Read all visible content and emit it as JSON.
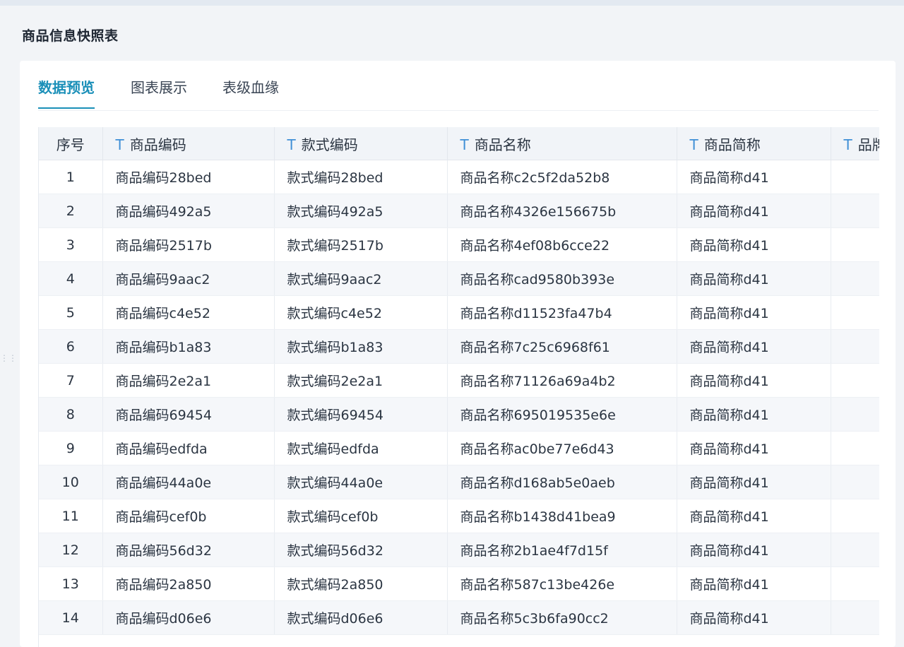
{
  "page": {
    "title": "商品信息快照表"
  },
  "tabs": [
    {
      "label": "数据预览",
      "active": true
    },
    {
      "label": "图表展示",
      "active": false
    },
    {
      "label": "表级血缘",
      "active": false
    }
  ],
  "table": {
    "columns": [
      "序号",
      "商品编码",
      "款式编码",
      "商品名称",
      "商品简称",
      "品牌"
    ],
    "column_type_icon": "T",
    "rows": [
      [
        "1",
        "商品编码28bed",
        "款式编码28bed",
        "商品名称c2c5f2da52b8",
        "商品简称d41",
        ""
      ],
      [
        "2",
        "商品编码492a5",
        "款式编码492a5",
        "商品名称4326e156675b",
        "商品简称d41",
        ""
      ],
      [
        "3",
        "商品编码2517b",
        "款式编码2517b",
        "商品名称4ef08b6cce22",
        "商品简称d41",
        ""
      ],
      [
        "4",
        "商品编码9aac2",
        "款式编码9aac2",
        "商品名称cad9580b393e",
        "商品简称d41",
        ""
      ],
      [
        "5",
        "商品编码c4e52",
        "款式编码c4e52",
        "商品名称d11523fa47b4",
        "商品简称d41",
        ""
      ],
      [
        "6",
        "商品编码b1a83",
        "款式编码b1a83",
        "商品名称7c25c6968f61",
        "商品简称d41",
        ""
      ],
      [
        "7",
        "商品编码2e2a1",
        "款式编码2e2a1",
        "商品名称71126a69a4b2",
        "商品简称d41",
        ""
      ],
      [
        "8",
        "商品编码69454",
        "款式编码69454",
        "商品名称695019535e6e",
        "商品简称d41",
        ""
      ],
      [
        "9",
        "商品编码edfda",
        "款式编码edfda",
        "商品名称ac0be77e6d43",
        "商品简称d41",
        ""
      ],
      [
        "10",
        "商品编码44a0e",
        "款式编码44a0e",
        "商品名称d168ab5e0aeb",
        "商品简称d41",
        ""
      ],
      [
        "11",
        "商品编码cef0b",
        "款式编码cef0b",
        "商品名称b1438d41bea9",
        "商品简称d41",
        ""
      ],
      [
        "12",
        "商品编码56d32",
        "款式编码56d32",
        "商品名称2b1ae4f7d15f",
        "商品简称d41",
        ""
      ],
      [
        "13",
        "商品编码2a850",
        "款式编码2a850",
        "商品名称587c13be426e",
        "商品简称d41",
        ""
      ],
      [
        "14",
        "商品编码d06e6",
        "款式编码d06e6",
        "商品名称5c3b6fa90cc2",
        "商品简称d41",
        ""
      ]
    ]
  },
  "colors": {
    "accent": "#1a8fb8",
    "type_icon": "#3f8fd6",
    "header_bg": "#f1f4f8",
    "stripe_bg": "#f5f7fa"
  }
}
